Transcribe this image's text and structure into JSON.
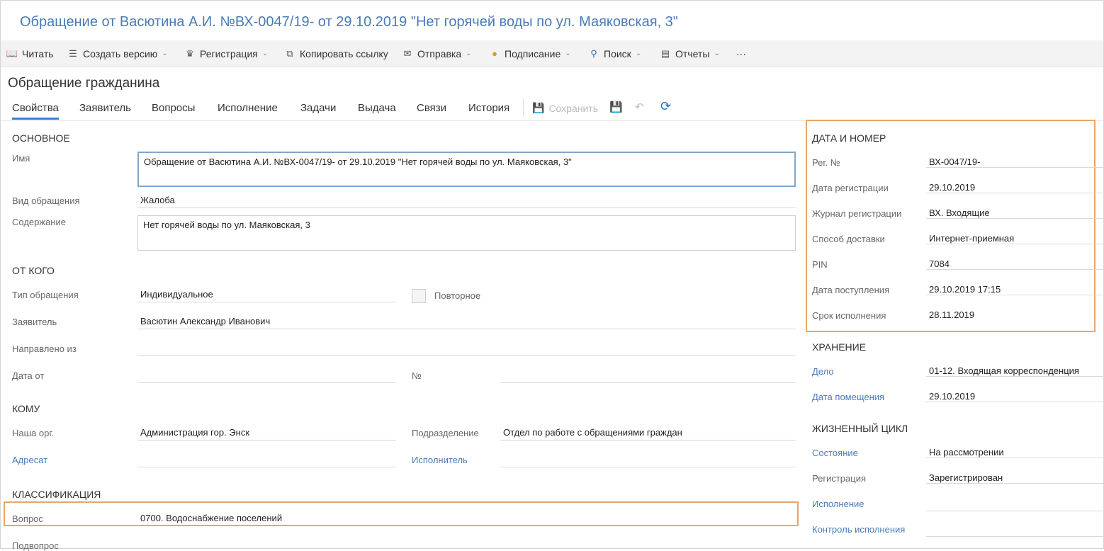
{
  "window_title": "Обращение от Васютина А.И. №ВХ-0047/19- от 29.10.2019 \"Нет горячей воды по ул. Маяковская, 3\"",
  "toolbar": {
    "read": "Читать",
    "create_version": "Создать версию",
    "registration": "Регистрация",
    "copy_link": "Копировать ссылку",
    "send": "Отправка",
    "sign": "Подписание",
    "search": "Поиск",
    "reports": "Отчеты",
    "more": "···"
  },
  "subtitle": "Обращение гражданина",
  "tabs": [
    "Свойства",
    "Заявитель",
    "Вопросы",
    "Исполнение",
    "Задачи",
    "Выдача",
    "Связи",
    "История"
  ],
  "save_label": "Сохранить",
  "main": {
    "section_main": "ОСНОВНОЕ",
    "name_label": "Имя",
    "name_value": "Обращение от Васютина А.И. №ВХ-0047/19- от 29.10.2019 \"Нет горячей воды по ул. Маяковская, 3\"",
    "kind_label": "Вид обращения",
    "kind_value": "Жалоба",
    "content_label": "Содержание",
    "content_value": "Нет горячей воды по ул. Маяковская, 3",
    "section_from": "ОТ КОГО",
    "type_label": "Тип обращения",
    "type_value": "Индивидуальное",
    "repeat_label": "Повторное",
    "applicant_label": "Заявитель",
    "applicant_value": "Васютин Александр Иванович",
    "sent_from_label": "Направлено из",
    "date_from_label": "Дата от",
    "number_label": "№",
    "section_to": "КОМУ",
    "our_org_label": "Наша орг.",
    "our_org_value": "Администрация гор. Энск",
    "department_label": "Подразделение",
    "department_value": "Отдел по работе с обращениями граждан",
    "addressee_label": "Адресат",
    "executor_label": "Исполнитель",
    "section_class": "КЛАССИФИКАЦИЯ",
    "question_label": "Вопрос",
    "question_value": "0700. Водоснабжение поселений",
    "subquestion_label": "Подвопрос"
  },
  "right": {
    "section_date": "ДАТА И НОМЕР",
    "reg_no_label": "Рег. №",
    "reg_no_value": "ВХ-0047/19-",
    "reg_date_label": "Дата регистрации",
    "reg_date_value": "29.10.2019",
    "journal_label": "Журнал регистрации",
    "journal_value": "ВХ. Входящие",
    "delivery_label": "Способ доставки",
    "delivery_value": "Интернет-приемная",
    "pin_label": "PIN",
    "pin_value": "7084",
    "received_label": "Дата поступления",
    "received_value": "29.10.2019 17:15",
    "deadline_label": "Срок исполнения",
    "deadline_value": "28.11.2019",
    "section_storage": "ХРАНЕНИЕ",
    "case_label": "Дело",
    "case_value": "01-12. Входящая корреспонденция",
    "placed_label": "Дата помещения",
    "placed_value": "29.10.2019",
    "section_life": "ЖИЗНЕННЫЙ ЦИКЛ",
    "state_label": "Состояние",
    "state_value": "На рассмотрении",
    "registration_label": "Регистрация",
    "registration_value": "Зарегистрирован",
    "execution_label": "Исполнение",
    "control_label": "Контроль исполнения"
  },
  "colors": {
    "accent": "#4a7bb7",
    "highlight": "#e8a569",
    "tab_underline": "#3b7dd8"
  }
}
